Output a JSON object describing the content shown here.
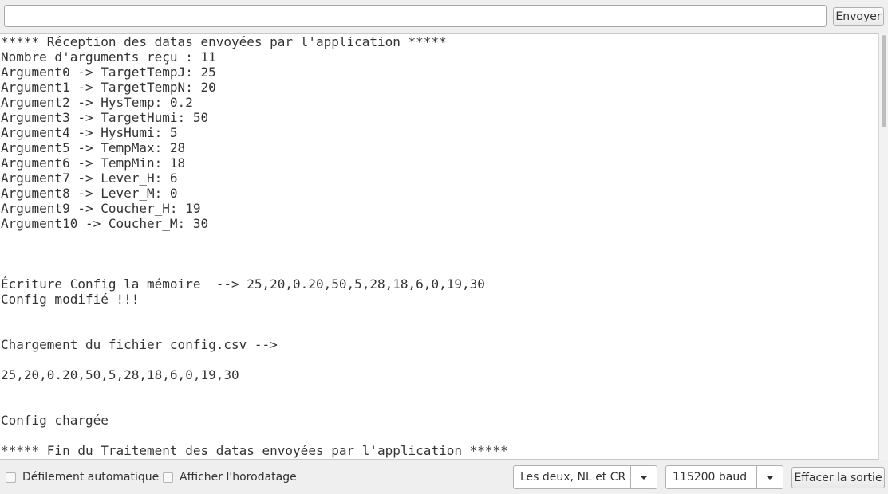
{
  "send_bar": {
    "input_value": "",
    "input_placeholder": "",
    "send_label": "Envoyer"
  },
  "output": {
    "lines": [
      "***** Réception des datas envoyées par l'application *****",
      "Nombre d'arguments reçu : 11",
      "Argument0 -> TargetTempJ: 25",
      "Argument1 -> TargetTempN: 20",
      "Argument2 -> HysTemp: 0.2",
      "Argument3 -> TargetHumi: 50",
      "Argument4 -> HysHumi: 5",
      "Argument5 -> TempMax: 28",
      "Argument6 -> TempMin: 18",
      "Argument7 -> Lever_H: 6",
      "Argument8 -> Lever_M: 0",
      "Argument9 -> Coucher_H: 19",
      "Argument10 -> Coucher_M: 30",
      "",
      "",
      "",
      "Écriture Config la mémoire  --> 25,20,0.20,50,5,28,18,6,0,19,30",
      "Config modifié !!!",
      "",
      "",
      "Chargement du fichier config.csv -->",
      "",
      "25,20,0.20,50,5,28,18,6,0,19,30",
      "",
      "",
      "Config chargée",
      "",
      "***** Fin du Traitement des datas envoyées par l'application *****"
    ],
    "scroll_position": 0
  },
  "bottom_bar": {
    "autoscroll_label": "Défilement automatique",
    "autoscroll_checked": false,
    "timestamp_label": "Afficher l'horodatage",
    "timestamp_checked": false,
    "line_ending_value": "Les deux, NL et CR",
    "baud_value": "115200 baud",
    "clear_label": "Effacer la sortie"
  }
}
